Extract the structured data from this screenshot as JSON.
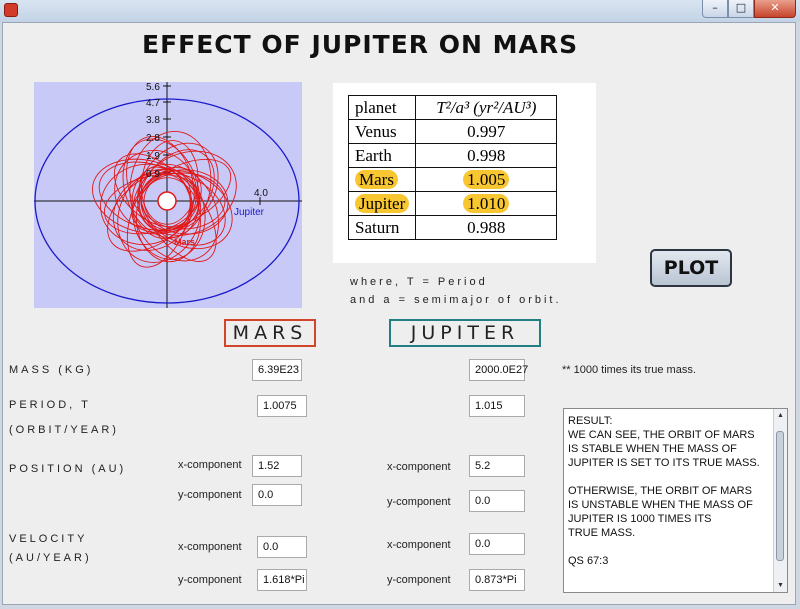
{
  "window": {
    "minimize_glyph": "–",
    "maximize_glyph": "□",
    "close_glyph": "✕",
    "icons": [
      "java-app-icon",
      "minimize-icon",
      "maximize-icon",
      "close-icon"
    ]
  },
  "title": "EFFECT OF JUPITER ON MARS",
  "plot": {
    "yticks": [
      "5.6",
      "4.7",
      "3.8",
      "2.8",
      "1.9",
      "0.9"
    ],
    "xtick": "4.0",
    "jupiter_label": "Jupiter",
    "mars_label": "Mars",
    "colors": {
      "background": "#c9c9f7",
      "jupiter": "#1a1acc",
      "mars": "#e01818",
      "sun": "#ffffff"
    }
  },
  "table": {
    "header_planet": "planet",
    "header_ratio": "T²/a³ (yr²/AU³)",
    "rows": [
      {
        "planet": "Venus",
        "value": "0.997"
      },
      {
        "planet": "Earth",
        "value": "0.998"
      },
      {
        "planet": "Mars",
        "value": "1.005"
      },
      {
        "planet": "Jupiter",
        "value": "1.010"
      },
      {
        "planet": "Saturn",
        "value": "0.988"
      }
    ],
    "highlight_color": "#f7c631"
  },
  "notes": {
    "line1": "where,  T = Period",
    "line2": "and  a = semimajor of orbit."
  },
  "plot_button": "PLOT",
  "headers": {
    "mars": "MARS",
    "jupiter": "JUPITER"
  },
  "labels": {
    "mass": "MASS (KG)",
    "period": "PERIOD, T",
    "period_unit": "(ORBIT/YEAR)",
    "position": "POSITION (AU)",
    "velocity": "VELOCITY",
    "velocity_unit": "(AU/YEAR)",
    "xcomp": "x-component",
    "ycomp": "y-component"
  },
  "mars": {
    "mass": "6.39E23",
    "period": "1.0075",
    "pos_x": "1.52",
    "pos_y": "0.0",
    "vel_x": "0.0",
    "vel_y": "1.618*Pi"
  },
  "jupiter": {
    "mass": "2000.0E27",
    "period": "1.015",
    "pos_x": "5.2",
    "pos_y": "0.0",
    "vel_x": "0.0",
    "vel_y": "0.873*Pi"
  },
  "mass_note": "** 1000 times its true mass.",
  "result": "RESULT:\nWE CAN SEE, THE ORBIT OF MARS\nIS STABLE WHEN THE MASS OF\nJUPITER IS SET TO ITS TRUE MASS.\n\nOTHERWISE, THE ORBIT OF MARS\nIS UNSTABLE WHEN THE MASS OF\nJUPITER IS 1000 TIMES ITS\nTRUE MASS.\n\nQS 67:3"
}
